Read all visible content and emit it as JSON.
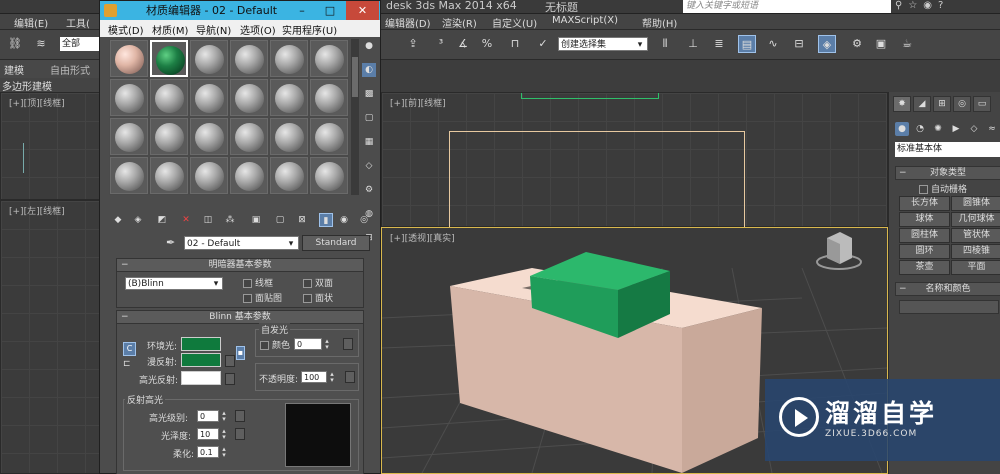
{
  "app": {
    "title": "desk 3ds Max  2014 x64",
    "doc_name": "无标题",
    "search_placeholder": "键入关键字或短语"
  },
  "main_menu": {
    "edit": "编辑(E)",
    "tools": "工具(",
    "group": "编辑器(D)",
    "render": "渲染(R)",
    "customize": "自定义(U)",
    "maxscript": "MAXScript(X)",
    "help": "帮助(H)"
  },
  "main_toolbar": {
    "selection_filter": "全部",
    "named_selection_set": "创建选择集"
  },
  "ribbon": {
    "modeling_tab": "建模",
    "freeform_tab": "自由形式",
    "polygon_modeling": "多边形建模"
  },
  "viewports": {
    "top_left_label": "[+][顶][线框]",
    "left_label": "[+][左][线框]",
    "front_label": "[+][前][线框]",
    "perspective_label": "[+][透视][真实]"
  },
  "command_panel": {
    "category_dropdown": "标准基本体",
    "object_type_title": "对象类型",
    "autogrid_label": "自动栅格",
    "object_buttons": [
      "长方体",
      "圆锥体",
      "球体",
      "几何球体",
      "圆柱体",
      "管状体",
      "圆环",
      "四棱锥",
      "茶壶",
      "平面"
    ],
    "name_color_title": "名称和颜色"
  },
  "material_editor": {
    "title": "材质编辑器 - 02 - Default",
    "menu": [
      "模式(D)",
      "材质(M)",
      "导航(N)",
      "选项(O)",
      "实用程序(U)"
    ],
    "material_name": "02 - Default",
    "material_type": "Standard",
    "shader_rollout": {
      "title": "明暗器基本参数",
      "shader": "(B)Blinn",
      "wire": "线框",
      "two_sided": "双面",
      "face_map": "面贴图",
      "faceted": "面状"
    },
    "blinn_rollout": {
      "title": "Blinn 基本参数",
      "self_illum_title": "自发光",
      "color_label": "颜色",
      "self_illum_value": "0",
      "ambient_label": "环境光:",
      "diffuse_label": "漫反射:",
      "specular_label": "高光反射:",
      "ambient_color": "#0f7a3d",
      "diffuse_color": "#0f7a3d",
      "specular_color": "#ffffff",
      "opacity_label": "不透明度:",
      "opacity_value": "100"
    },
    "specular_highlights": {
      "title": "反射高光",
      "level_label": "高光级别:",
      "level_value": "0",
      "gloss_label": "光泽度:",
      "gloss_value": "10",
      "soften_label": "柔化:",
      "soften_value": "0.1"
    }
  },
  "scene": {
    "box_color": "#e9cabb",
    "green_box_color": "#1f9d5a"
  },
  "watermark": {
    "brand": "溜溜自学",
    "url": "ZIXUE.3D66.COM"
  }
}
